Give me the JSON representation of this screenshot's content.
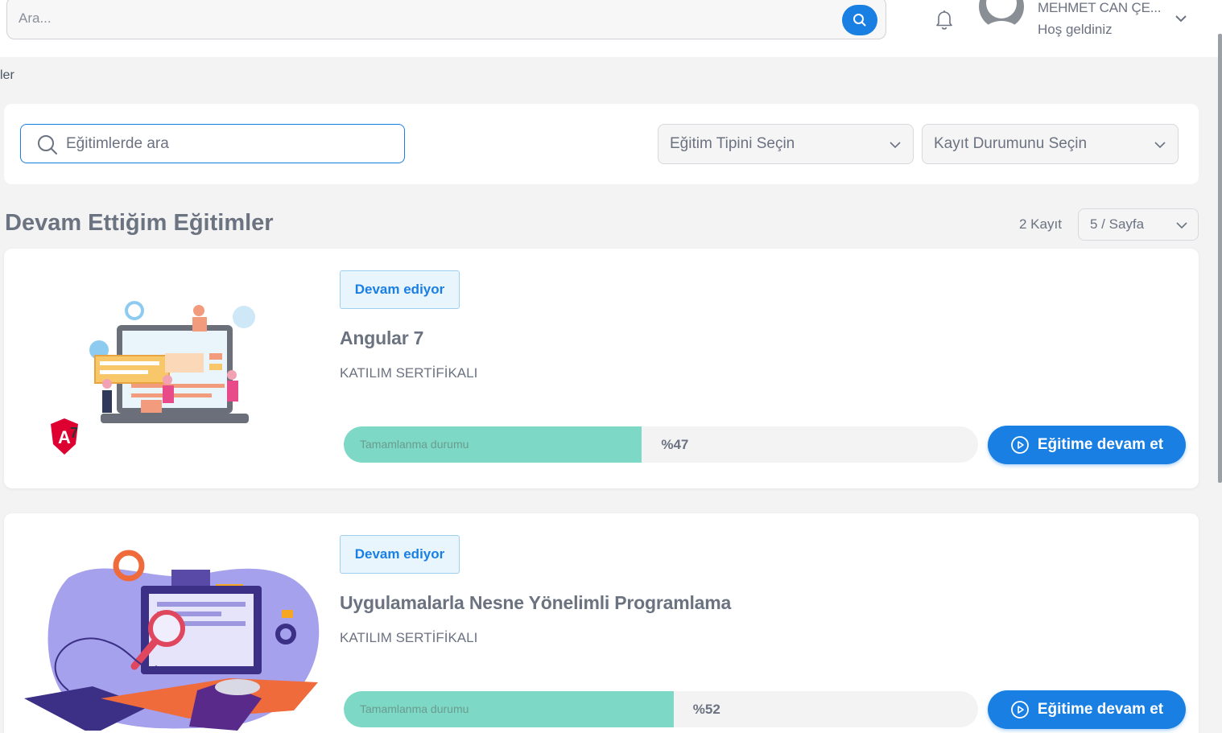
{
  "header": {
    "search_placeholder": "Ara...",
    "user_name": "MEHMET CAN ÇE...",
    "welcome": "Hoş geldiniz"
  },
  "breadcrumb": "ler",
  "filters": {
    "search_placeholder": "Eğitimlerde ara",
    "type_select": "Eğitim Tipini Seçin",
    "status_select": "Kayıt Durumunu Seçin"
  },
  "section": {
    "title": "Devam Ettiğim Eğitimler",
    "record_count": "2 Kayıt",
    "page_size": "5 / Sayfa"
  },
  "courses": [
    {
      "status": "Devam ediyor",
      "title": "Angular 7",
      "certificate": "KATILIM SERTİFİKALI",
      "progress_label": "Tamamlanma durumu",
      "progress_text": "%47",
      "progress": 47,
      "button": "Eğitime devam et"
    },
    {
      "status": "Devam ediyor",
      "title": "Uygulamalarla Nesne Yönelimli Programlama",
      "certificate": "KATILIM SERTİFİKALI",
      "progress_label": "Tamamlanma durumu",
      "progress_text": "%52",
      "progress": 52,
      "button": "Eğitime devam et"
    }
  ],
  "colors": {
    "primary": "#1a7fe3",
    "progress_fill": "#7dd9c5",
    "badge_bg": "#e8f5fd"
  }
}
